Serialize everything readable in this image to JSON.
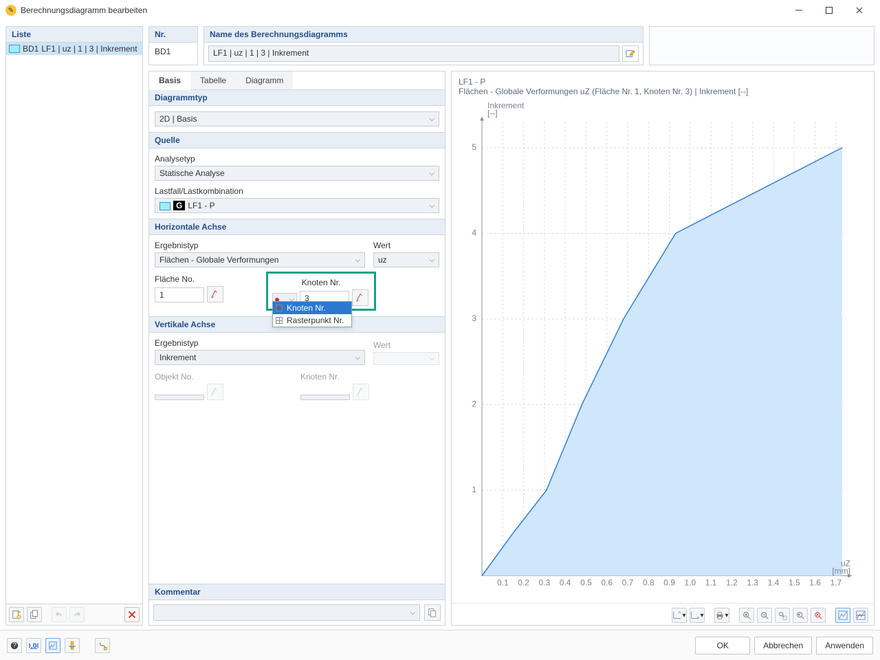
{
  "window": {
    "title": "Berechnungsdiagramm bearbeiten"
  },
  "list": {
    "title": "Liste",
    "items": [
      {
        "code": "BD1",
        "desc": "LF1 | uz | 1 | 3 | Inkrement"
      }
    ],
    "toolbar": {
      "new": "Neu",
      "dup": "Duplizieren",
      "undo": "Rückgängig",
      "redo": "Wiederholen",
      "del": "Löschen"
    }
  },
  "header": {
    "nr_label": "Nr.",
    "nr_value": "BD1",
    "name_label": "Name des Berechnungsdiagramms",
    "name_value": "LF1 | uz | 1 | 3 | Inkrement"
  },
  "tabs": {
    "basis": "Basis",
    "tabelle": "Tabelle",
    "diagramm": "Diagramm"
  },
  "form": {
    "diagramtyp": {
      "title": "Diagrammtyp",
      "value": "2D | Basis"
    },
    "quelle": {
      "title": "Quelle",
      "analysetyp_label": "Analysetyp",
      "analysetyp_value": "Statische Analyse",
      "lastfall_label": "Lastfall/Lastkombination",
      "lastfall_code": "G",
      "lastfall_value": "LF1 - P"
    },
    "haxis": {
      "title": "Horizontale Achse",
      "ergebnistyp_label": "Ergebnistyp",
      "ergebnistyp_value": "Flächen - Globale Verformungen",
      "wert_label": "Wert",
      "wert_value": "uz",
      "flaeche_label": "Fläche No.",
      "flaeche_value": "1",
      "knoten_label": "Knoten Nr.",
      "knoten_value": "3",
      "dd_option1": "Knoten Nr.",
      "dd_option2": "Rasterpunkt Nr."
    },
    "vaxis": {
      "title": "Vertikale Achse",
      "ergebnistyp_label": "Ergebnistyp",
      "ergebnistyp_value": "Inkrement",
      "wert_label": "Wert",
      "objekt_label": "Objekt No.",
      "knoten_label": "Knoten Nr."
    }
  },
  "comment": {
    "title": "Kommentar",
    "value": ""
  },
  "chart": {
    "title1": "LF1 - P",
    "title2": "Flächen - Globale Verformungen uZ (Fläche Nr. 1, Knoten Nr. 3) | Inkrement [--]",
    "yaxis_label": "Inkrement",
    "yaxis_unit": "[--]",
    "xaxis_label": "uZ",
    "xaxis_unit": "[mm]"
  },
  "chart_data": {
    "type": "area",
    "x": [
      0.0,
      0.15,
      0.31,
      0.48,
      0.68,
      0.93,
      1.73
    ],
    "y": [
      0,
      0.5,
      1.0,
      2.0,
      3.0,
      4.0,
      5.0
    ],
    "xticks": [
      0.1,
      0.2,
      0.3,
      0.4,
      0.5,
      0.6,
      0.7,
      0.8,
      0.9,
      1.0,
      1.1,
      1.2,
      1.3,
      1.4,
      1.5,
      1.6,
      1.7
    ],
    "yticks": [
      1,
      2,
      3,
      4,
      5
    ],
    "xlim": [
      0.0,
      1.75
    ],
    "ylim": [
      0,
      5.3
    ],
    "xlabel": "uZ [mm]",
    "ylabel": "Inkrement [--]",
    "title": "Flächen - Globale Verformungen uZ (Fläche Nr. 1, Knoten Nr. 3) | Inkrement [--]"
  },
  "buttons": {
    "ok": "OK",
    "cancel": "Abbrechen",
    "apply": "Anwenden"
  }
}
